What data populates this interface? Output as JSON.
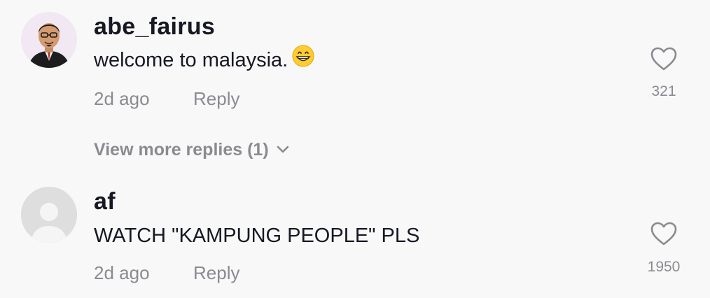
{
  "comments": [
    {
      "username": "abe_fairus",
      "text": "welcome to malaysia.",
      "emoji": "grinning-face-icon",
      "time": "2d ago",
      "reply_label": "Reply",
      "likes": "321",
      "view_more": "View more replies (1)"
    },
    {
      "username": "af",
      "text": "WATCH \"KAMPUNG PEOPLE\" PLS",
      "time": "2d ago",
      "reply_label": "Reply",
      "likes": "1950"
    }
  ],
  "colors": {
    "background": "#f8f8f8",
    "primary_text": "#161823",
    "secondary_text": "#8a8b91"
  }
}
